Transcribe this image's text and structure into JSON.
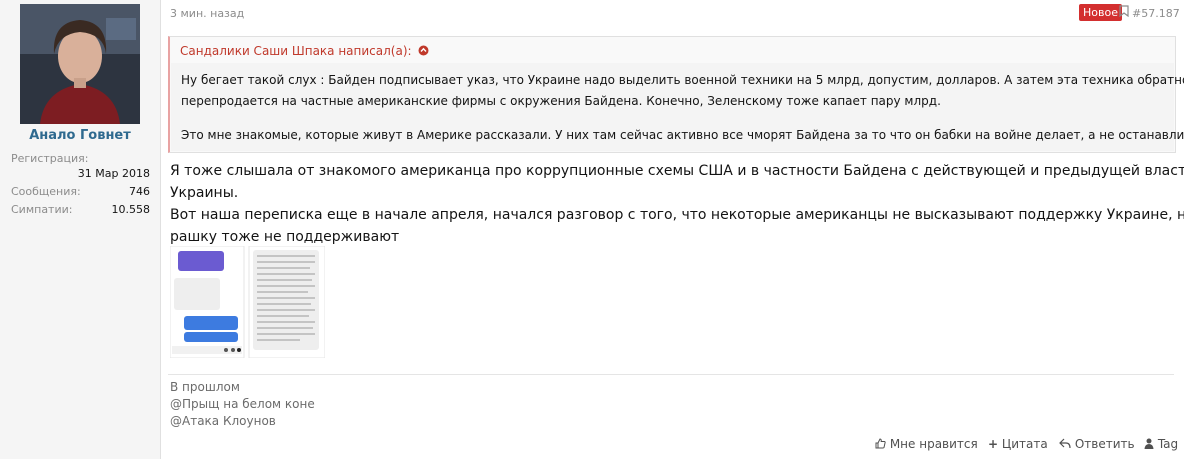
{
  "user": {
    "name": "Анало Говнет",
    "reg_label": "Регистрация:",
    "reg_date": "31 Мар 2018",
    "posts_label": "Сообщения:",
    "posts_value": "746",
    "likes_label": "Симпатии:",
    "likes_value": "10.558"
  },
  "post": {
    "time": "3 мин. назад",
    "badge": "Новое",
    "number": "#57.187",
    "quote": {
      "header": "Сандалики Саши Шпака написал(а):",
      "line1": "Ну бегает такой слух : Байден подписывает указ, что Украине надо выделить военной техники на 5 млрд, допустим, долларов. А затем эта техника обратно",
      "line2": "перепродается на частные американские фирмы с окружения Байдена. Конечно, Зеленскому тоже капает пару млрд.",
      "line3": "Это мне знакомые, которые живут в Америке рассказали. У них там сейчас активно все чморят Байдена за то что он бабки на войне делает, а не останавливает ее."
    },
    "body": {
      "line1": "Я тоже слышала от знакомого американца про коррупционные схемы США и в частности Байдена с действующей и предыдущей властью",
      "line2": "Украины.",
      "line3": "Вот наша переписка еще в начале апреля, начался разговор с того, что некоторые американцы не высказывают поддержку Украине, но и",
      "line4": "рашку тоже не поддерживают"
    },
    "signature": {
      "line1": "В прошлом",
      "line2": "@Прыщ на белом коне",
      "line3": "@Атака Клоунов"
    },
    "actions": {
      "like": "Мне нравится",
      "quote": "Цитата",
      "reply": "Ответить",
      "tag": "Tag"
    }
  },
  "colors": {
    "username": "#2f6a8f",
    "badge": "#d32f2f",
    "quote_header": "#c0392b"
  }
}
